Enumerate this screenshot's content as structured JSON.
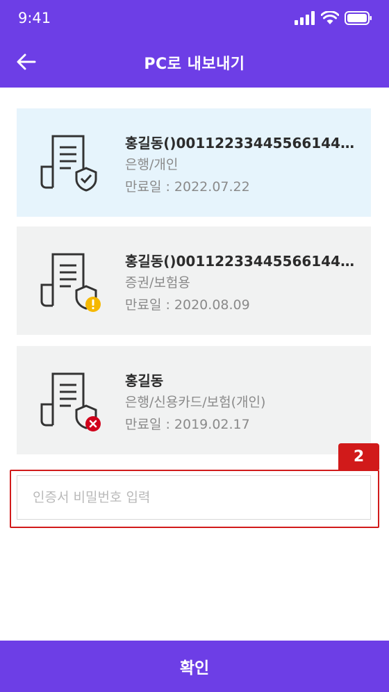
{
  "status_bar": {
    "time": "9:41"
  },
  "nav": {
    "title": "PC로 내보내기"
  },
  "certificates": [
    {
      "name": "홍길동()001122334455661445…",
      "type": "은행/개인",
      "expiry": "만료일 : 2022.07.22",
      "status": "valid",
      "selected": true
    },
    {
      "name": "홍길동()001122334455661445…",
      "type": "증권/보험용",
      "expiry": "만료일 : 2020.08.09",
      "status": "warning",
      "selected": false
    },
    {
      "name": "홍길동",
      "type": "은행/신용카드/보험(개인)",
      "expiry": "만료일 : 2019.02.17",
      "status": "expired",
      "selected": false
    }
  ],
  "annotation": {
    "badge": "2"
  },
  "password": {
    "placeholder": "인증서 비밀번호 입력",
    "value": ""
  },
  "footer": {
    "confirm_label": "확인"
  },
  "colors": {
    "brand": "#6d3ee6",
    "selected_bg": "#e6f4fc",
    "card_bg": "#f1f2f2",
    "warning": "#f5b800",
    "error": "#d0021b",
    "annotation": "#d11a1a"
  }
}
